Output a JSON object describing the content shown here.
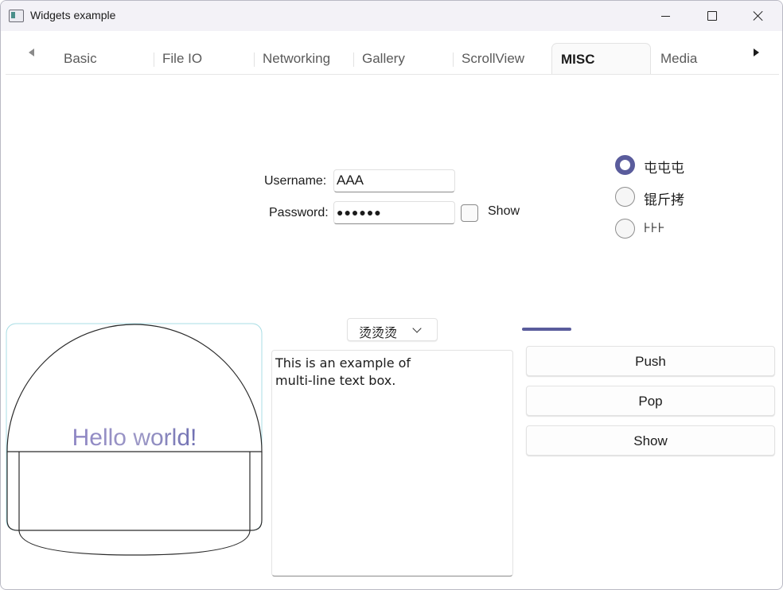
{
  "window": {
    "title": "Widgets example"
  },
  "tabs": {
    "items": [
      {
        "label": "Basic"
      },
      {
        "label": "File IO"
      },
      {
        "label": "Networking"
      },
      {
        "label": "Gallery"
      },
      {
        "label": "ScrollView"
      },
      {
        "label": "MISC"
      },
      {
        "label": "Media"
      }
    ],
    "active": "MISC"
  },
  "login": {
    "username_label": "Username:",
    "username_value": "AAA",
    "password_label": "Password:",
    "password_value": "●●●●●●",
    "show_label": "Show",
    "show_checked": false
  },
  "radios": {
    "items": [
      {
        "label": "屯屯屯",
        "checked": true
      },
      {
        "label": "锟斤拷",
        "checked": false
      },
      {
        "label": "⊦⊦⊦",
        "checked": false
      }
    ]
  },
  "canvas": {
    "text": "Hello world!"
  },
  "combo": {
    "selected": "烫烫烫"
  },
  "textbox": {
    "value": "This is an example of\nmulti-line text box."
  },
  "progress": {
    "fraction": 0.2
  },
  "buttons": {
    "push": "Push",
    "pop": "Pop",
    "show": "Show"
  },
  "colors": {
    "accent": "#5a5c9c",
    "canvas_border": "#a8dde4"
  }
}
